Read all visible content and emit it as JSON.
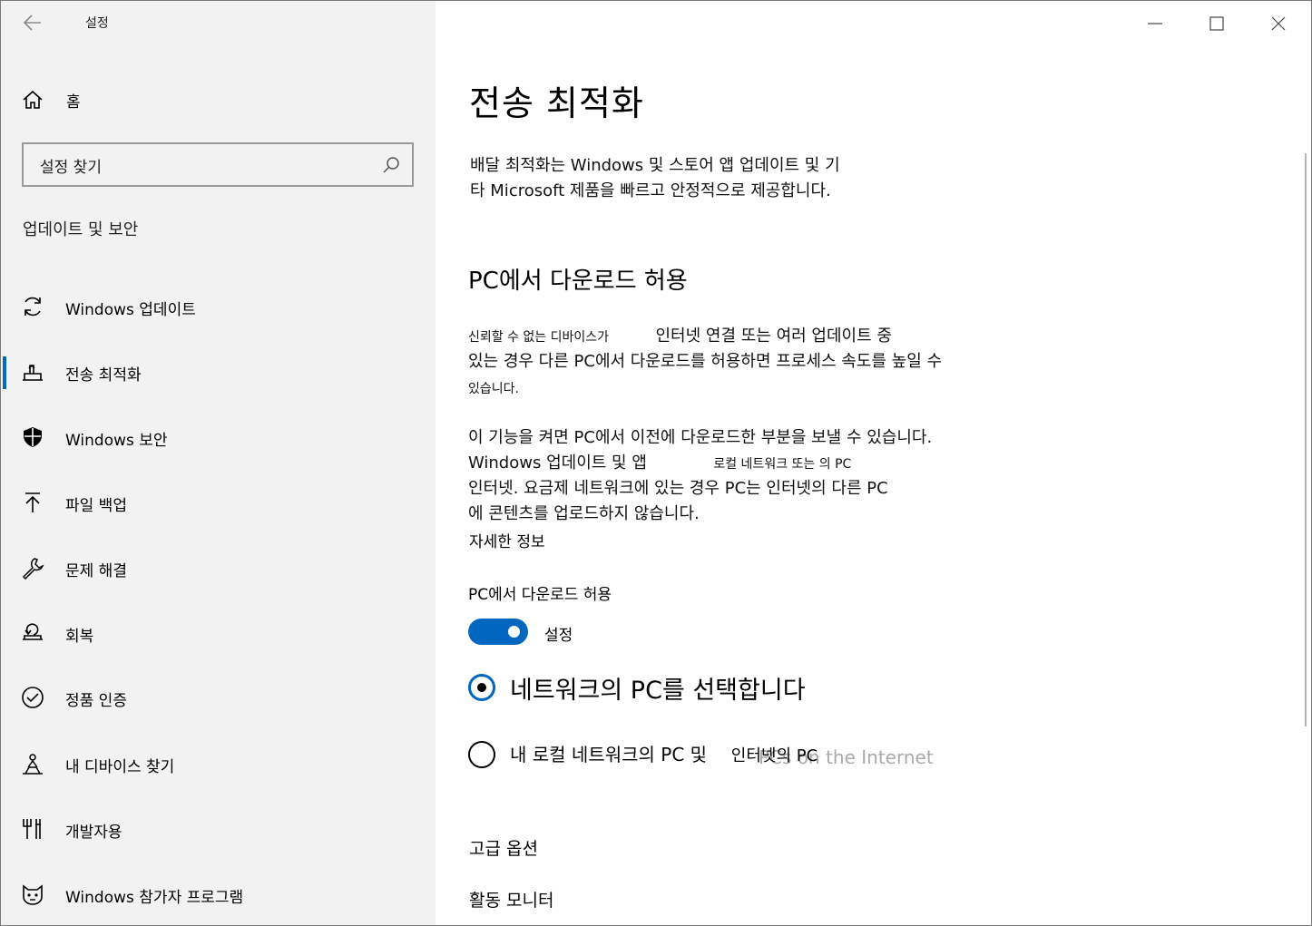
{
  "window": {
    "title": "설정",
    "controls": {
      "minimize": "minimize-icon",
      "maximize": "maximize-icon",
      "close": "close-icon"
    }
  },
  "sidebar": {
    "home_label": "홈",
    "search_placeholder": "설정 찾기",
    "section_title": "업데이트 및 보안",
    "items": [
      {
        "label": "Windows 업데이트",
        "icon": "sync-icon"
      },
      {
        "label": "전송 최적화",
        "icon": "delivery-icon",
        "selected": true
      },
      {
        "label": "Windows 보안",
        "icon": "shield-icon"
      },
      {
        "label": "파일 백업",
        "icon": "upload-arrow-icon"
      },
      {
        "label": "문제 해결",
        "icon": "wrench-icon"
      },
      {
        "label": "회복",
        "icon": "recovery-icon"
      },
      {
        "label": "정품 인증",
        "icon": "check-circle-icon"
      },
      {
        "label": "내 디바이스 찾기",
        "icon": "person-location-icon"
      },
      {
        "label": "개발자용",
        "icon": "developer-tools-icon"
      },
      {
        "label": "Windows 참가자 프로그램",
        "icon": "insider-cat-icon"
      }
    ]
  },
  "main": {
    "title": "전송 최적화",
    "intro_line1": "배달 최적화는 Windows 및 스토어 앱 업데이트 및 기",
    "intro_line2": "타 Microsoft 제품을 빠르고 안정적으로 제공합니다.",
    "section_title": "PC에서 다운로드 허용",
    "p1_line1_a": "신뢰할 수 없는 디바이스가",
    "p1_line1_b": "인터넷 연결 또는 여러 업데이트 중",
    "p1_line2": "있는 경우 다른 PC에서 다운로드를 허용하면 프로세스 속도를 높일 수",
    "p1_line3": "있습니다.",
    "p2_line1": "이 기능을 켜면 PC에서 이전에 다운로드한 부분을 보낼 수 있습니다.",
    "p2_line2_a": "Windows 업데이트 및 앱",
    "p2_line2_b": "로컬 네트워크 또는 의 PC",
    "p2_line3": "인터넷. 요금제 네트워크에 있는 경우 PC는 인터넷의 다른 PC",
    "p2_line4": "에 콘텐츠를 업로드하지 않습니다.",
    "learn_more": "자세한 정보",
    "toggle_label": "PC에서 다운로드 허용",
    "toggle_state": "설정",
    "toggle_on": true,
    "radio_options": [
      {
        "label": "네트워크의 PC를 선택합니다",
        "checked": true
      },
      {
        "label": "내 로컬 네트워크의 PC 및",
        "label_b": "인터넷의 PC",
        "ghost": "PCs on the Internet",
        "checked": false
      }
    ],
    "advanced_options": "고급 옵션",
    "activity_monitor": "활동 모니터"
  },
  "colors": {
    "accent": "#0067c0",
    "sidebar_bg": "#f2f2f2"
  }
}
